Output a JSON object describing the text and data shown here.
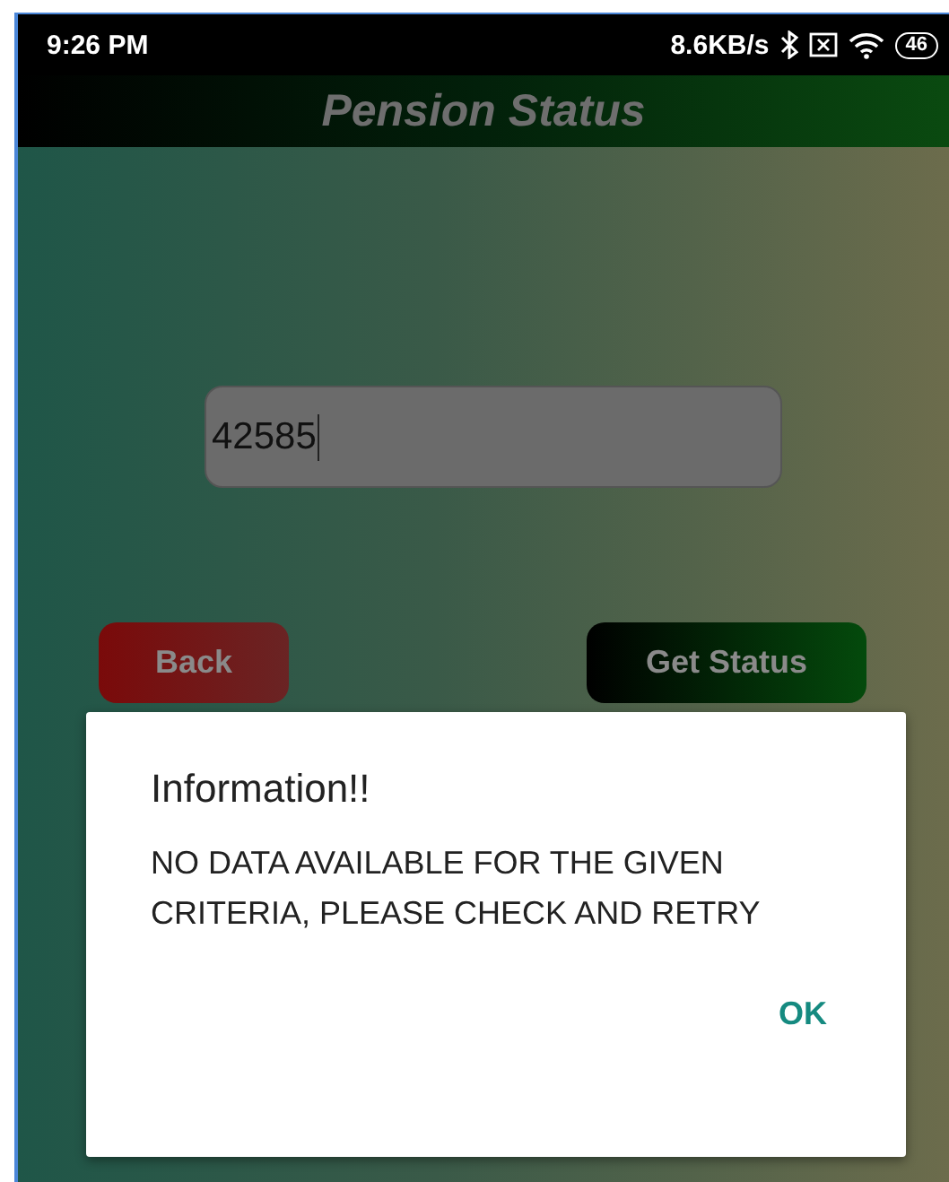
{
  "status_bar": {
    "time": "9:26 PM",
    "speed": "8.6KB/s",
    "battery": "46"
  },
  "app_bar": {
    "title": "Pension Status"
  },
  "input": {
    "value": "42585"
  },
  "buttons": [
    {
      "label": "Back",
      "kind": "back"
    },
    {
      "label": "Get Status",
      "kind": "primary"
    }
  ],
  "dialog": {
    "title": "Information!!",
    "message": "NO DATA AVAILABLE FOR THE GIVEN CRITERIA, PLEASE CHECK AND RETRY",
    "button": "OK"
  }
}
